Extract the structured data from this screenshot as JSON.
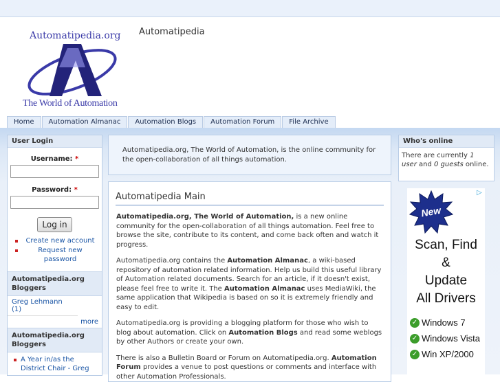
{
  "header": {
    "logo_top": "Automatipedia.org",
    "logo_bottom": "The World of Automation",
    "site_name": "Automatipedia"
  },
  "tabs": [
    {
      "label": "Home"
    },
    {
      "label": "Automation Almanac"
    },
    {
      "label": "Automation Blogs"
    },
    {
      "label": "Automation Forum"
    },
    {
      "label": "File Archive"
    }
  ],
  "login": {
    "title": "User Login",
    "username_label": "Username:",
    "password_label": "Password:",
    "required_mark": "*",
    "login_button": "Log in",
    "create_account": "Create new account",
    "request_password": "Request new password"
  },
  "bloggers": {
    "title": "Automatipedia.org Bloggers",
    "items": [
      "Greg Lehmann (1)"
    ],
    "more": "more"
  },
  "posts": {
    "title": "Automatipedia.org Bloggers",
    "items": [
      "A Year in/as the District Chair - Greg"
    ]
  },
  "mission": "Automatipedia.org, The World of Automation, is the online community for the open-collaboration of all things automation.",
  "main": {
    "title": "Automatipedia Main",
    "p1_bold": "Automatipedia.org, The World of Automation,",
    "p1_rest": " is a new online community for the open-collaboration of all things automation. Feel free to browse the site, contribute to its content, and come back often and watch it progress.",
    "p2_a": "Automatipedia.org contains the ",
    "p2_b": "Automation Almanac",
    "p2_c": ", a wiki-based repository of automation related information. Help us build this useful library of Automation related documents. Search for an article, if it doesn't exist, please feel free to write it. The ",
    "p2_d": "Automation Almanac",
    "p2_e": " uses MediaWiki, the same application that Wikipedia is based on so it is extremely friendly and easy to edit.",
    "p3_a": "Automatipedia.org is providing a blogging platform for those who wish to blog about automation. Click on ",
    "p3_b": "Automation Blogs",
    "p3_c": " and read some weblogs by other Authors or create your own.",
    "p4_a": "There is also a Bulletin Board or Forum on Automatipedia.org. ",
    "p4_b": "Automation Forum",
    "p4_c": " provides a venue to post questions or comments and interface with other Automation Professionals."
  },
  "whos_online": {
    "title": "Who's online",
    "text_a": "There are currently ",
    "users": "1 user",
    "text_b": " and ",
    "guests": "0 guests",
    "text_c": " online."
  },
  "ad": {
    "badge": "New",
    "line1": "Scan, Find",
    "line2": "&",
    "line3": "Update",
    "line4": "All Drivers",
    "os": [
      "Windows 7",
      "Windows Vista",
      "Win XP/2000"
    ],
    "choices_icon": "adchoices-icon"
  },
  "colors": {
    "accent": "#1a55a5",
    "band": "#c4d8f1",
    "logo": "#3a3aa8"
  }
}
